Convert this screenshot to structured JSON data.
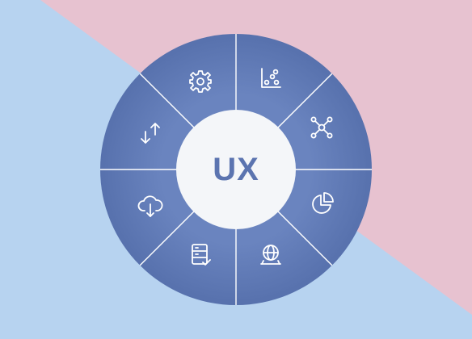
{
  "colors": {
    "background_pink": "#e7c2d0",
    "background_blue": "#b7d3f0",
    "ring": "#5771ad",
    "ring_inner": "#6a84bf",
    "divider": "#ffffff",
    "center_fill": "#f4f6f9",
    "center_text": "#5b74b0",
    "icon": "#ffffff"
  },
  "center": {
    "label": "UX"
  },
  "segments": [
    {
      "icon": "scatter-chart-icon"
    },
    {
      "icon": "network-nodes-icon"
    },
    {
      "icon": "pie-chart-icon"
    },
    {
      "icon": "globe-monitor-icon"
    },
    {
      "icon": "server-check-icon"
    },
    {
      "icon": "cloud-download-icon"
    },
    {
      "icon": "sync-arrows-icon"
    },
    {
      "icon": "gear-icon"
    }
  ]
}
